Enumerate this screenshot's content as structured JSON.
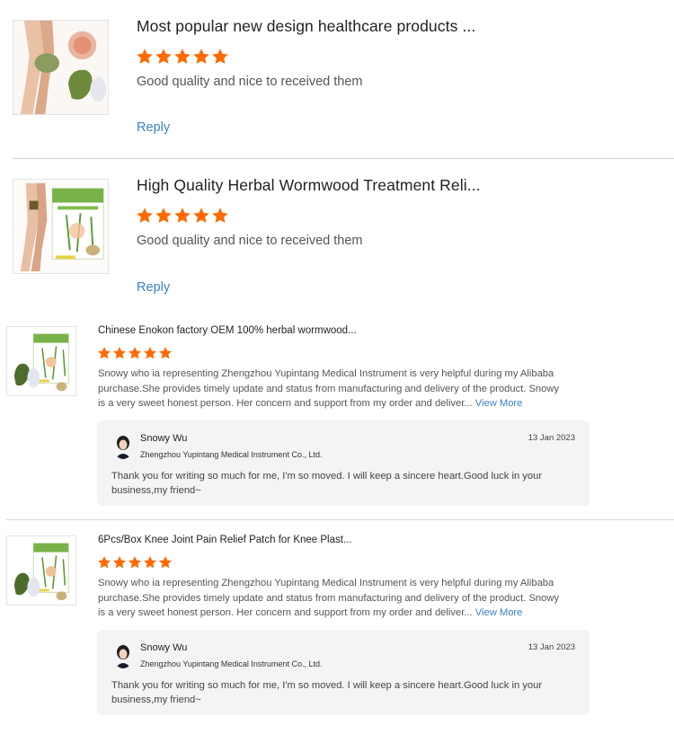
{
  "colors": {
    "star": "#ff6a00",
    "link": "#3d7fc6",
    "divider": "#d6d6d6",
    "reply_bg": "#f4f4f6"
  },
  "reviews": [
    {
      "product_title": "Most popular new design healthcare products ...",
      "rating": 5,
      "text": "Good quality and nice to received them",
      "reply_label": "Reply",
      "thumb_icon": "knee-patch-product-icon"
    },
    {
      "product_title": "High Quality Herbal Wormwood Treatment Reli...",
      "rating": 5,
      "text": "Good quality and nice to received them",
      "reply_label": "Reply",
      "thumb_icon": "herbal-patch-box-icon"
    },
    {
      "product_title": "Chinese Enokon factory OEM 100% herbal wormwood...",
      "rating": 5,
      "text": "Snowy who ia representing Zhengzhou Yupintang Medical Instrument is very helpful during my Alibaba purchase.She provides timely update and status from manufacturing and delivery of the product. Snowy is a very sweet honest person. Her concern and support from my order and deliver...",
      "view_more": "View More",
      "thumb_icon": "wormwood-patch-box-icon",
      "seller_reply": {
        "name": "Snowy Wu",
        "company": "Zhengzhou Yupintang Medical Instrument Co., Ltd.",
        "date": "13 Jan 2023",
        "text": "Thank you for writing so much for me, I'm so moved. I will keep a sincere heart.Good luck in your business,my friend~"
      }
    },
    {
      "product_title": "6Pcs/Box Knee Joint Pain Relief Patch for Knee Plast...",
      "rating": 5,
      "text": "Snowy who ia representing Zhengzhou Yupintang Medical Instrument is very helpful during my Alibaba purchase.She provides timely update and status from manufacturing and delivery of the product. Snowy is a very sweet honest person. Her concern and support from my order and deliver...",
      "view_more": "View More",
      "thumb_icon": "knee-joint-patch-box-icon",
      "seller_reply": {
        "name": "Snowy Wu",
        "company": "Zhengzhou Yupintang Medical Instrument Co., Ltd.",
        "date": "13 Jan 2023",
        "text": "Thank you for writing so much for me, I'm so moved. I will keep a sincere heart.Good luck in your business,my friend~"
      }
    }
  ]
}
